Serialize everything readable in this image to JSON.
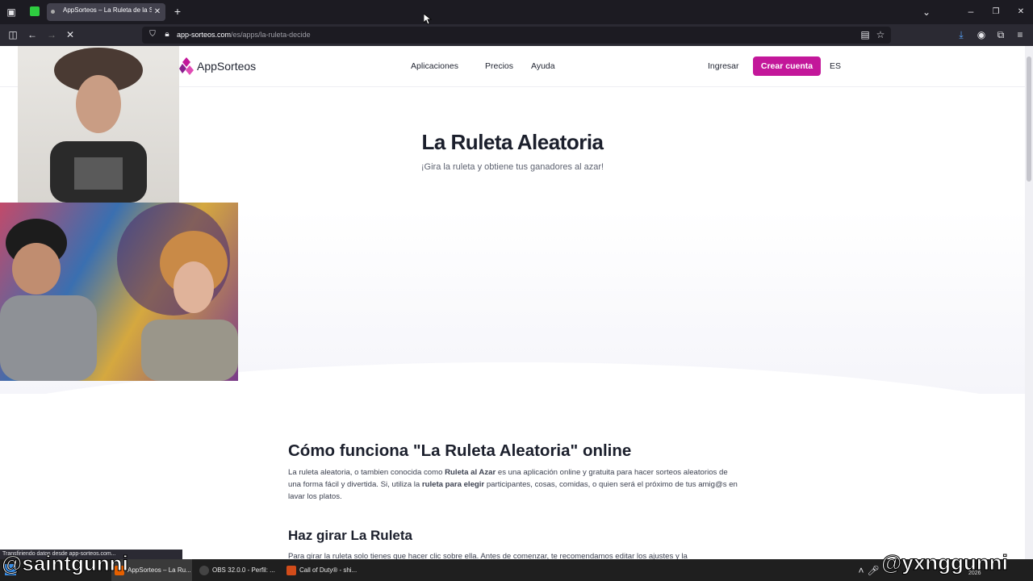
{
  "browser": {
    "tab_title": "AppSorteos – La Ruleta de la Suerte",
    "url_domain": "app-sorteos.com",
    "url_path": "/es/apps/la-ruleta-decide",
    "new_tab_icon": "plus-icon",
    "status_text": "Transfiriendo datos desde app-sorteos.com..."
  },
  "site": {
    "logo_text": "AppSorteos",
    "nav": [
      "Aplicaciones",
      "Precios",
      "Ayuda"
    ],
    "login": "Ingresar",
    "create_account": "Crear cuenta",
    "language": "ES",
    "brand_color": "#c3179a"
  },
  "hero": {
    "title": "La Ruleta Aleatoria",
    "subtitle": "¡Gira la ruleta y obtiene tus ganadores al azar!"
  },
  "content": {
    "section_title": "Cómo funciona \"La Ruleta Aleatoria\" online",
    "para_1": "La ruleta aleatoria, o tambien conocida como ",
    "para_bold_1": "Ruleta al Azar",
    "para_2": " es una aplicación online y gratuita para hacer sorteos aleatorios de una forma fácil y divertida. Si, utiliza la ",
    "para_bold_2": "ruleta para elegir",
    "para_3": " participantes, cosas, comidas, o quien será el próximo de tus amig@s en lavar los platos.",
    "section2_title": "Haz girar La Ruleta",
    "section2_text": "Para girar la ruleta solo tienes que hacer clic sobre ella. Antes de comenzar, te recomendamos editar los ajustes y la"
  },
  "taskbar": {
    "items": [
      "AppSorteos – La Ru...",
      "OBS 32.0.0 - Perfil: ...",
      "Call of Duty® - shi..."
    ],
    "time": "2026"
  },
  "overlay": {
    "watermark_left": "@saintgunni",
    "watermark_right": "@yxnggunni"
  }
}
